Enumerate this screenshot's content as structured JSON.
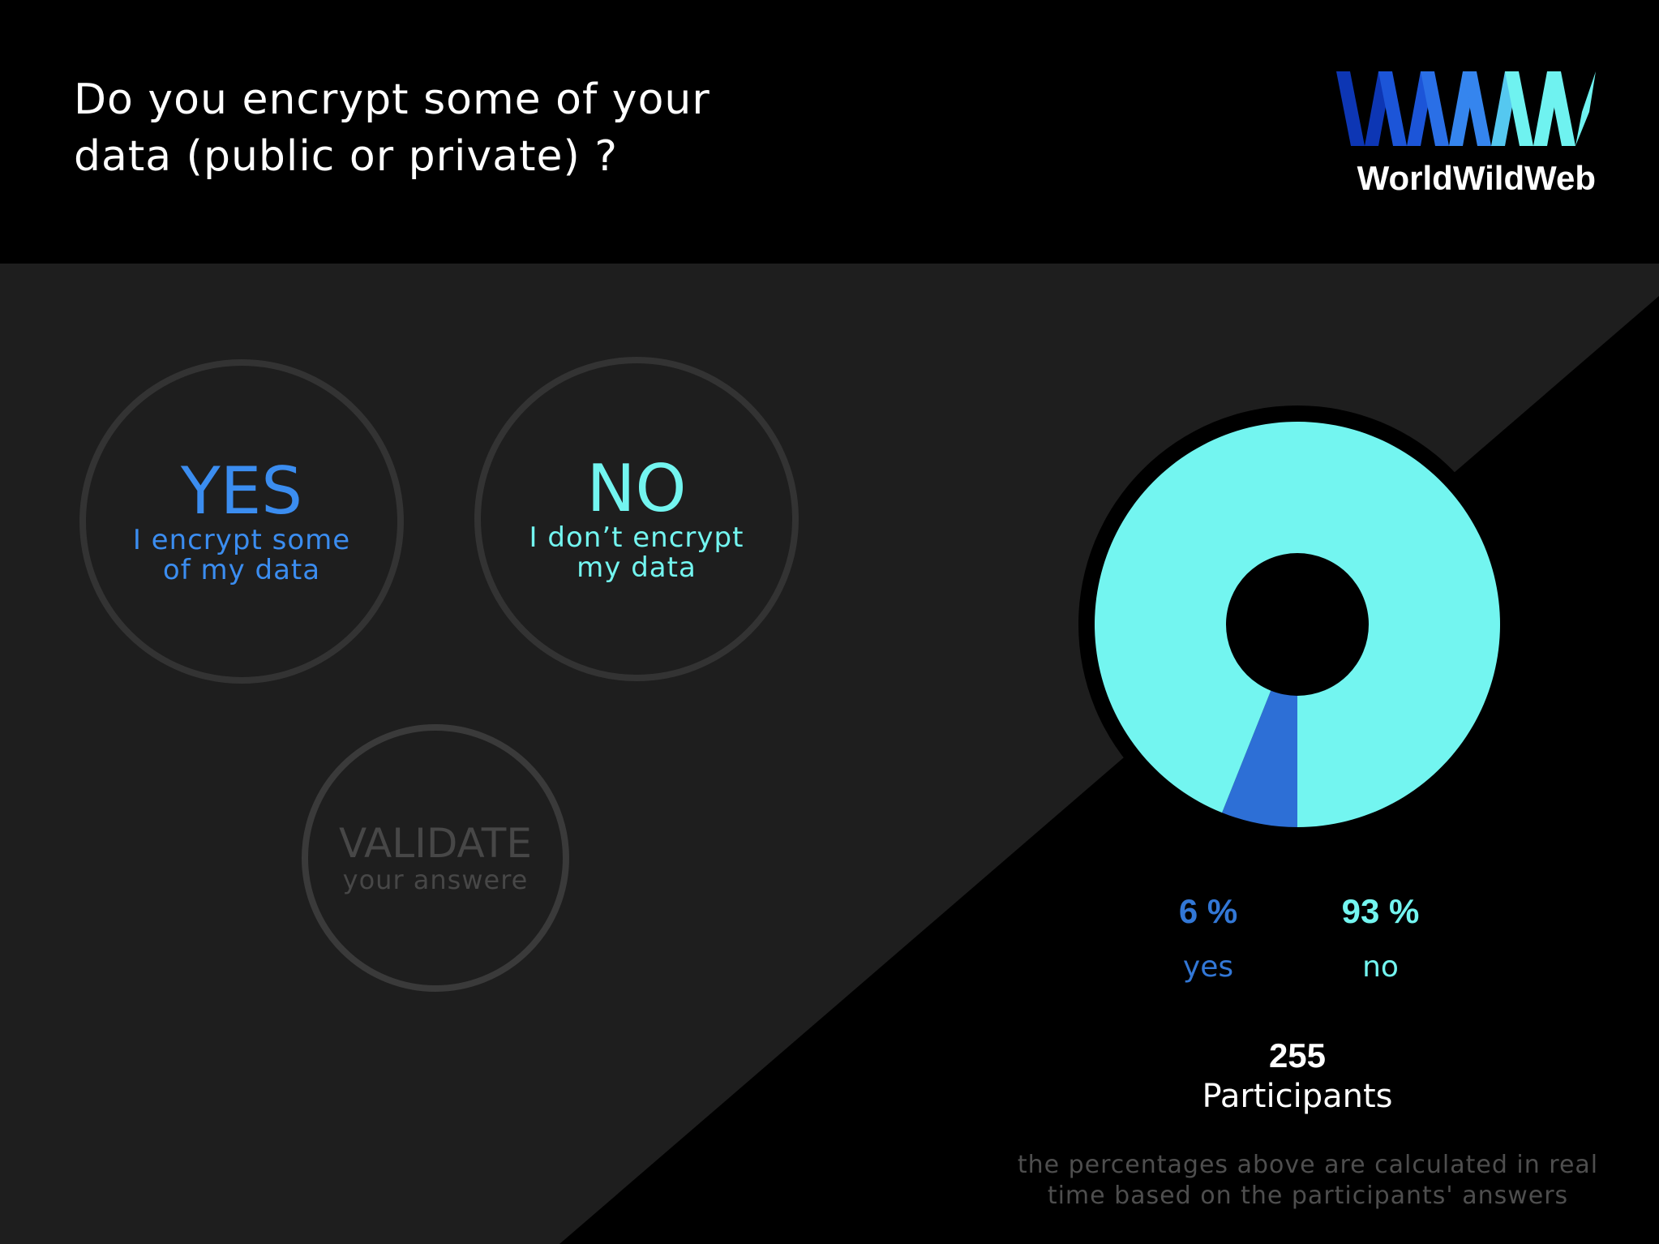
{
  "header": {
    "question_line1": "Do you encrypt some of your",
    "question_line2": "data (public or private) ?",
    "logo_text": "WorldWildWeb",
    "logo_mark": "WWW"
  },
  "choices": {
    "yes": {
      "title": "YES",
      "line1": "I encrypt some",
      "line2": "of my data"
    },
    "no": {
      "title": "NO",
      "line1": "I don’t encrypt",
      "line2": "my data"
    }
  },
  "validate": {
    "title": "VALIDATE",
    "subtitle": "your answere"
  },
  "results": {
    "yes_pct": "6 %",
    "yes_label": "yes",
    "no_pct": "93 %",
    "no_label": "no",
    "participants_count": "255",
    "participants_label": "Participants",
    "note_line1": "the percentages above are calculated in real",
    "note_line2": "time based on the participants' answers"
  },
  "colors": {
    "yes": "#2d6fd6",
    "no": "#73f5f0",
    "panel": "#1e1e1e",
    "logo": [
      "#0d36b4",
      "#1c55d8",
      "#3585ee",
      "#6ff2f0"
    ]
  },
  "chart_data": {
    "type": "pie",
    "categories": [
      "yes",
      "no"
    ],
    "values": [
      6,
      93
    ],
    "title": "",
    "donut": true
  }
}
